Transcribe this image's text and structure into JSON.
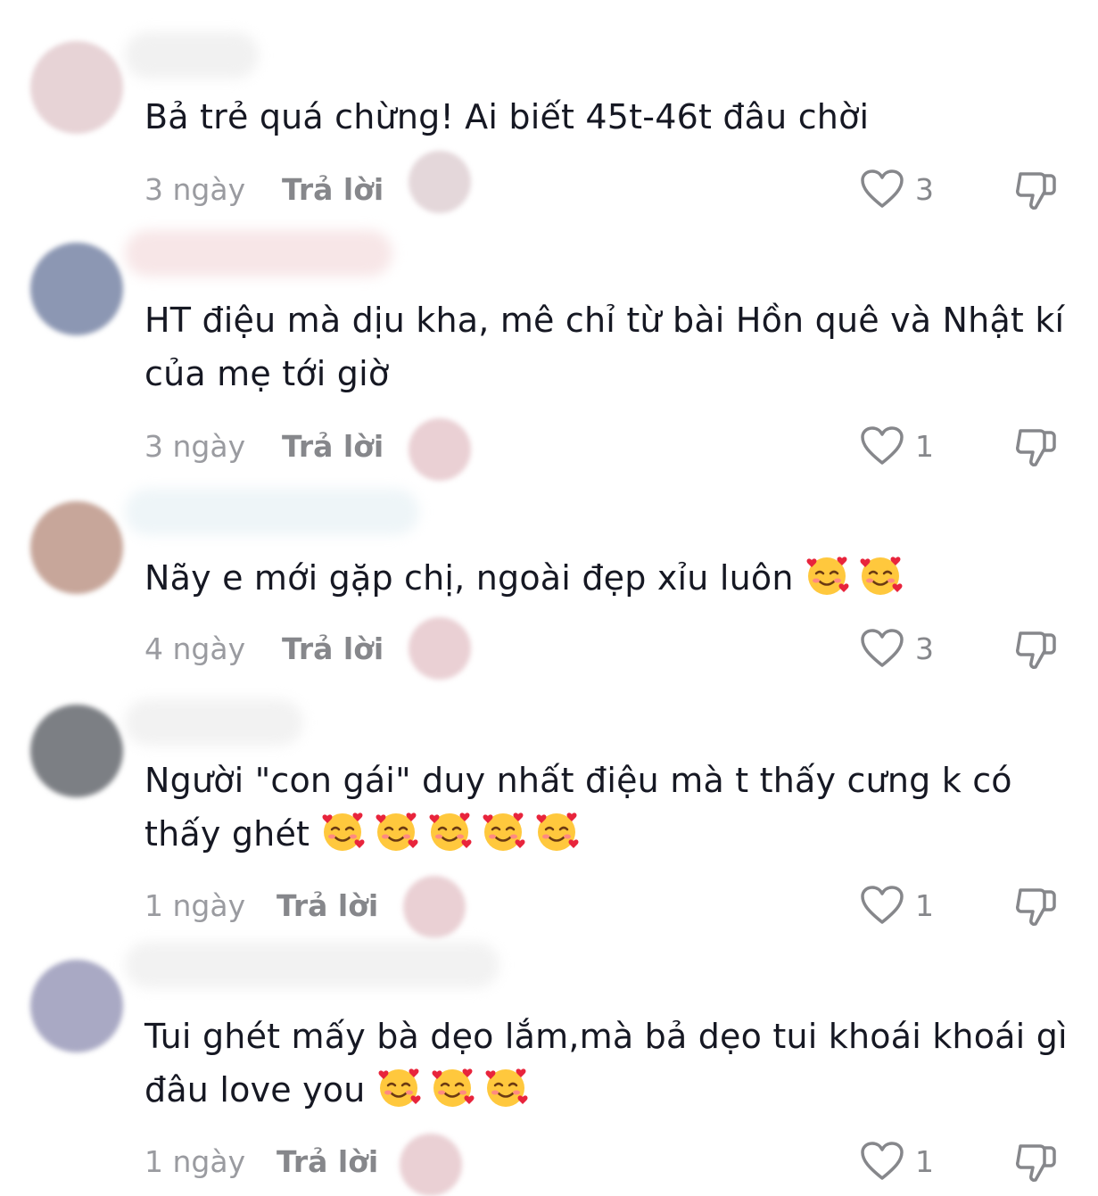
{
  "comments": [
    {
      "text": "Bả trẻ quá chừng! Ai biết 45t-46t đâu chời",
      "emoji_count": 0,
      "time": "3 ngày",
      "reply": "Trả lời",
      "likes": "3",
      "avatar_color": "#e7d3d6"
    },
    {
      "text": "HT điệu mà dịu kha, mê chỉ từ bài Hồn quê và Nhật kí của mẹ tới giờ",
      "emoji_count": 0,
      "time": "3 ngày",
      "reply": "Trả lời",
      "likes": "1",
      "avatar_color": "#8c97b3"
    },
    {
      "text": "Nãy e mới gặp chị, ngoài đẹp xỉu luôn",
      "emoji_count": 2,
      "time": "4 ngày",
      "reply": "Trả lời",
      "likes": "3",
      "avatar_color": "#c7a69a"
    },
    {
      "text": "Người \"con gái\" duy nhất điệu mà t thấy cưng k có thấy ghét",
      "emoji_count": 5,
      "time": "1 ngày",
      "reply": "Trả lời",
      "likes": "1",
      "avatar_color": "#7c7f84"
    },
    {
      "text": "Tui ghét mấy bà dẹo lắm,mà bả dẹo tui khoái khoái gì đâu love you",
      "emoji_count": 3,
      "time": "1 ngày",
      "reply": "Trả lời",
      "likes": "1",
      "avatar_color": "#a9a9c4"
    }
  ],
  "icons": {
    "emoji": "smiling-face-with-hearts",
    "like": "heart-outline-icon",
    "dislike": "thumbs-down-icon"
  },
  "colors": {
    "text": "#161823",
    "meta": "#86878b",
    "time": "#9a9ba0"
  }
}
